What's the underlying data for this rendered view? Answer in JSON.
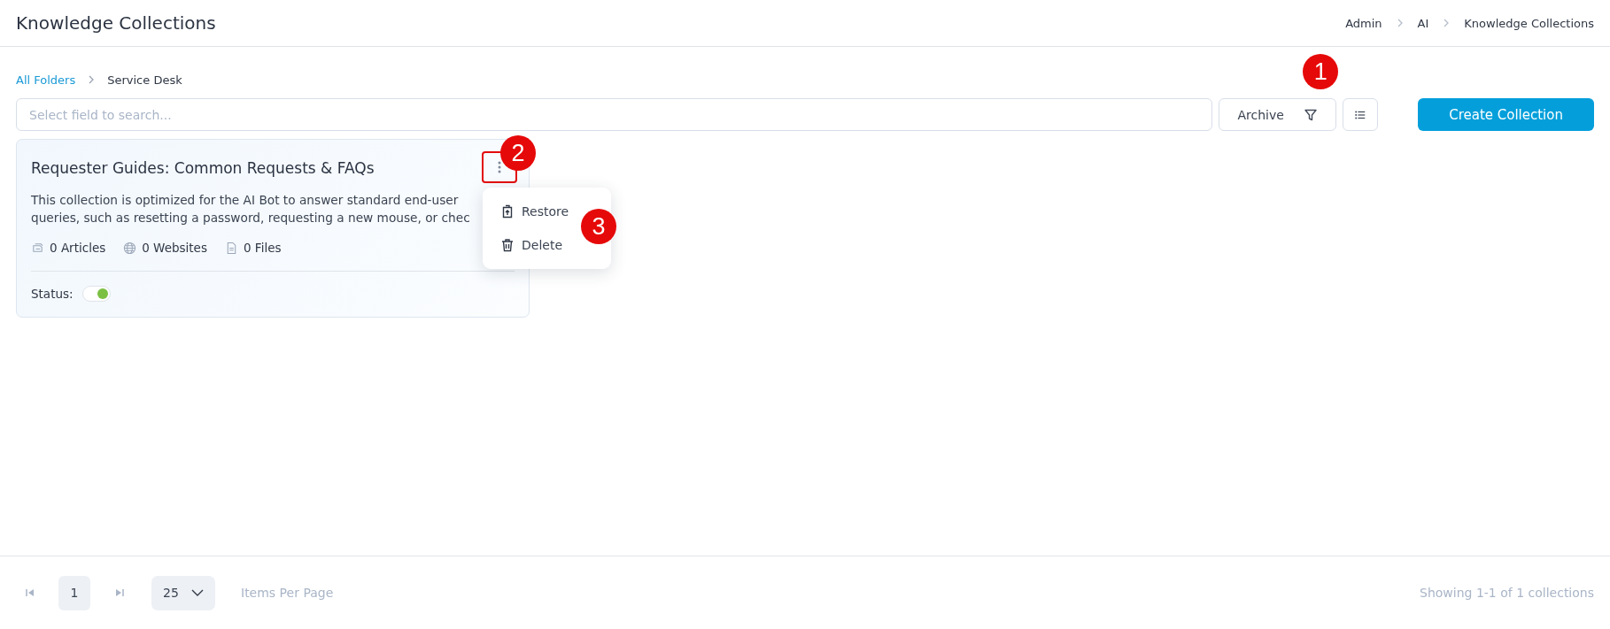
{
  "header": {
    "title": "Knowledge Collections",
    "breadcrumb": [
      "Admin",
      "AI",
      "Knowledge Collections"
    ]
  },
  "folder_path": [
    {
      "label": "All Folders",
      "link": true
    },
    {
      "label": "Service Desk",
      "link": false
    }
  ],
  "toolbar": {
    "search": {
      "placeholder": "Select field to search..."
    },
    "filter_button": {
      "label": "Archive",
      "callout": "1"
    },
    "create_button": {
      "label": "Create Collection"
    }
  },
  "collections": [
    {
      "title": "Requester Guides: Common Requests & FAQs",
      "description_lines": [
        "This collection is optimized for the AI Bot to answer standard end-user",
        "queries, such as resetting a password, requesting a new mouse, or chec"
      ],
      "stats": [
        {
          "kind": "articles",
          "label": "0 Articles"
        },
        {
          "kind": "websites",
          "label": "0 Websites"
        },
        {
          "kind": "files",
          "label": "0 Files"
        }
      ],
      "status_label": "Status:",
      "status_on": true,
      "more_highlighted": true,
      "more_callout": "2",
      "menu_callout": "3",
      "menu": [
        {
          "kind": "restore",
          "label": "Restore"
        },
        {
          "kind": "delete",
          "label": "Delete"
        }
      ]
    }
  ],
  "pagination": {
    "pages": [
      {
        "label": "1",
        "selected": true
      }
    ],
    "page_size": "25",
    "page_size_label": "Items Per Page",
    "summary": "Showing 1-1 of 1 collections"
  }
}
